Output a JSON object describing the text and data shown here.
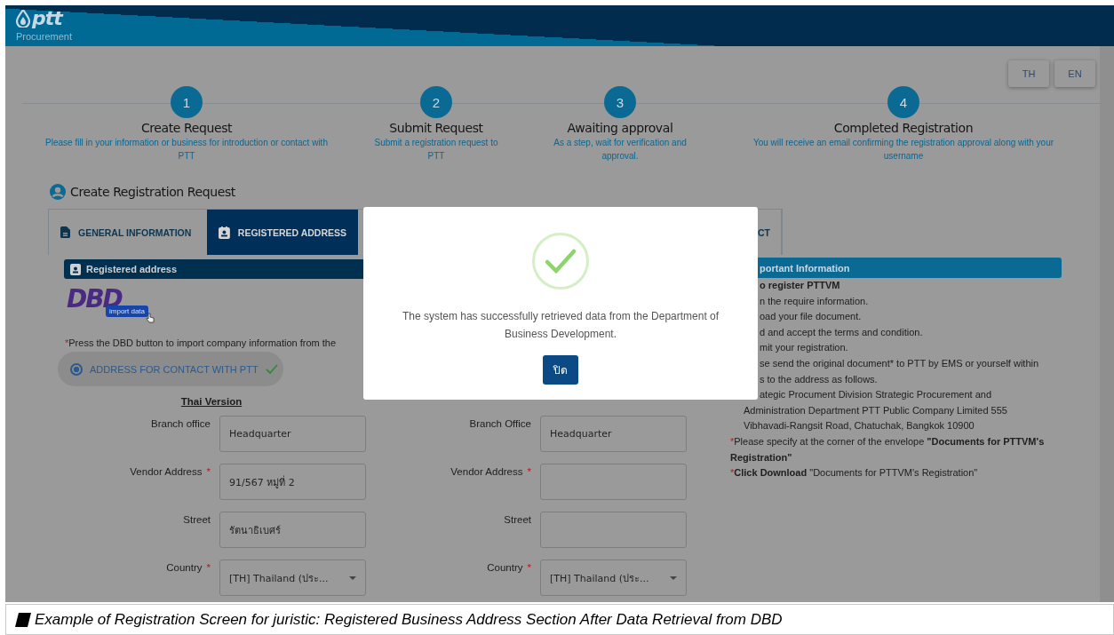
{
  "header": {
    "brand": "ptt",
    "subtitle": "Procurement"
  },
  "languages": [
    {
      "label": "TH"
    },
    {
      "label": "EN"
    }
  ],
  "steps": [
    {
      "number": "1",
      "title": "Create Request",
      "description": "Please fill in your information or business for introduction or contact with PTT"
    },
    {
      "number": "2",
      "title": "Submit Request",
      "description": "Submit a registration request to PTT"
    },
    {
      "number": "3",
      "title": "Awaiting approval",
      "description": "As a step, wait for verification and approval."
    },
    {
      "number": "4",
      "title": "Completed Registration",
      "description": "You will receive an email confirming the registration approval along with your username"
    }
  ],
  "page_title": "Create Registration Request",
  "tabs": [
    {
      "label": "GENERAL INFORMATION",
      "selected": false
    },
    {
      "label": "REGISTERED ADDRESS",
      "selected": true
    },
    {
      "label": "CT",
      "selected": false
    }
  ],
  "section_title": "Registered address",
  "dbd_button": {
    "logo": "DBD",
    "badge": "import data"
  },
  "dbd_note": {
    "mark": "*",
    "text": "Press the DBD button to import company information from the"
  },
  "address_option": {
    "label": "ADDRESS FOR CONTACT WITH PTT",
    "selected": true,
    "verified": true
  },
  "thai_version": {
    "title": "Thai Version",
    "fields": [
      {
        "label": "Branch office",
        "required": false,
        "kind": "text",
        "value": "Headquarter"
      },
      {
        "label": "Vendor Address",
        "required": true,
        "kind": "text",
        "value": "91/567 หมู่ที่ 2"
      },
      {
        "label": "Street",
        "required": false,
        "kind": "text",
        "value": "รัตนาธิเบศร์"
      },
      {
        "label": "Country",
        "required": true,
        "kind": "select",
        "value": "[TH] Thailand (ประ..."
      }
    ]
  },
  "international_version": {
    "fields": [
      {
        "label": "Branch Office",
        "required": false,
        "kind": "text",
        "value": "Headquarter"
      },
      {
        "label": "Vendor Address",
        "required": true,
        "kind": "text"
      },
      {
        "label": "Street",
        "required": false,
        "kind": "text"
      },
      {
        "label": "Country",
        "required": true,
        "kind": "select",
        "value": "[TH] Thailand (ประ..."
      }
    ]
  },
  "important_information": {
    "title": "portant Information",
    "lines": [
      {
        "kind": "cut",
        "bold": true,
        "text": "o register PTTVM"
      },
      {
        "kind": "cut",
        "bold": false,
        "text": "n the require information."
      },
      {
        "kind": "cut",
        "bold": false,
        "text": "oad your file document."
      },
      {
        "kind": "cut",
        "bold": false,
        "text": "d and accept the terms and condition."
      },
      {
        "kind": "cut",
        "bold": false,
        "text": "mit your registration."
      },
      {
        "kind": "cut",
        "bold": false,
        "text": "se send the original document* to PTT by EMS or yourself within"
      },
      {
        "kind": "cut",
        "bold": false,
        "text": "s to the address as follows."
      },
      {
        "kind": "cut",
        "bold": false,
        "text": "ategic Procument Division Strategic Procurement and"
      },
      {
        "kind": "indent",
        "bold": false,
        "text": "Administration Department PTT Public Company Limited 555"
      },
      {
        "kind": "indent",
        "bold": false,
        "text": "Vibhavadi-Rangsit Road, Chatuchak, Bangkok 10900"
      },
      {
        "kind": "note",
        "bold": false,
        "mark": "*",
        "text": "Please specify at the corner of the envelope **\"Documents for PTTVM's Registration\"**"
      },
      {
        "kind": "note",
        "bold": false,
        "mark": "*",
        "text": "**Click Download** \"Documents for PTTVM's Registration\""
      }
    ]
  },
  "dialog": {
    "message": "The system has successfully retrieved data from the Department of Business Development.",
    "button": "ปิด"
  },
  "caption": {
    "text": "Example of Registration Screen for juristic: Registered Business Address Section After Data Retrieval from DBD"
  }
}
